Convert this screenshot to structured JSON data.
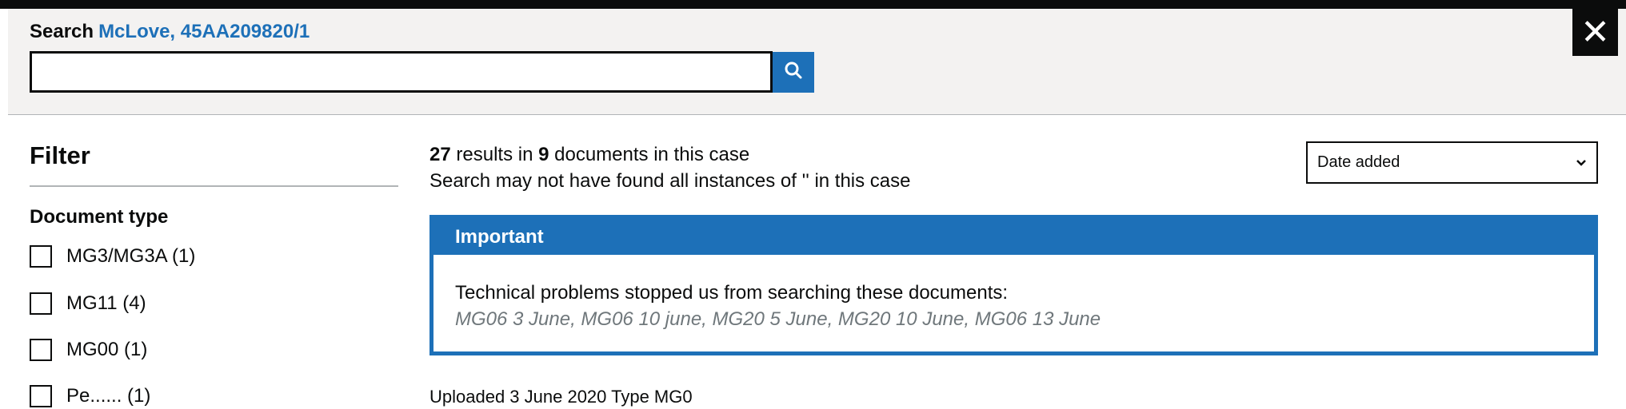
{
  "header": {
    "search_label": "Search",
    "case_name": "McLove, 45AA209820/1",
    "search_value": "",
    "search_button_icon": "search-icon",
    "close_icon": "close-icon"
  },
  "filter": {
    "heading": "Filter",
    "document_type_label": "Document type",
    "items": [
      {
        "label": "MG3/MG3A (1)",
        "checked": false
      },
      {
        "label": "MG11 (4)",
        "checked": false
      },
      {
        "label": "MG00 (1)",
        "checked": false
      },
      {
        "label": "Pe...... (1)",
        "checked": false
      }
    ]
  },
  "results": {
    "count": "27",
    "in_text": "results in",
    "doc_count": "9",
    "suffix": "documents in this case",
    "note": "Search may not have found all instances of '' in this case"
  },
  "sort": {
    "selected": "Date added"
  },
  "important": {
    "heading": "Important",
    "text": "Technical problems stopped us from searching these documents:",
    "documents": "MG06 3 June, MG06 10 june, MG20 5 June, MG20 10 June, MG06 13 June"
  },
  "next_result": "Uploaded 3 June 2020 Type MG0",
  "colors": {
    "brand_blue": "#1d70b8",
    "text": "#0b0c0c",
    "header_bg": "#f3f2f1"
  }
}
